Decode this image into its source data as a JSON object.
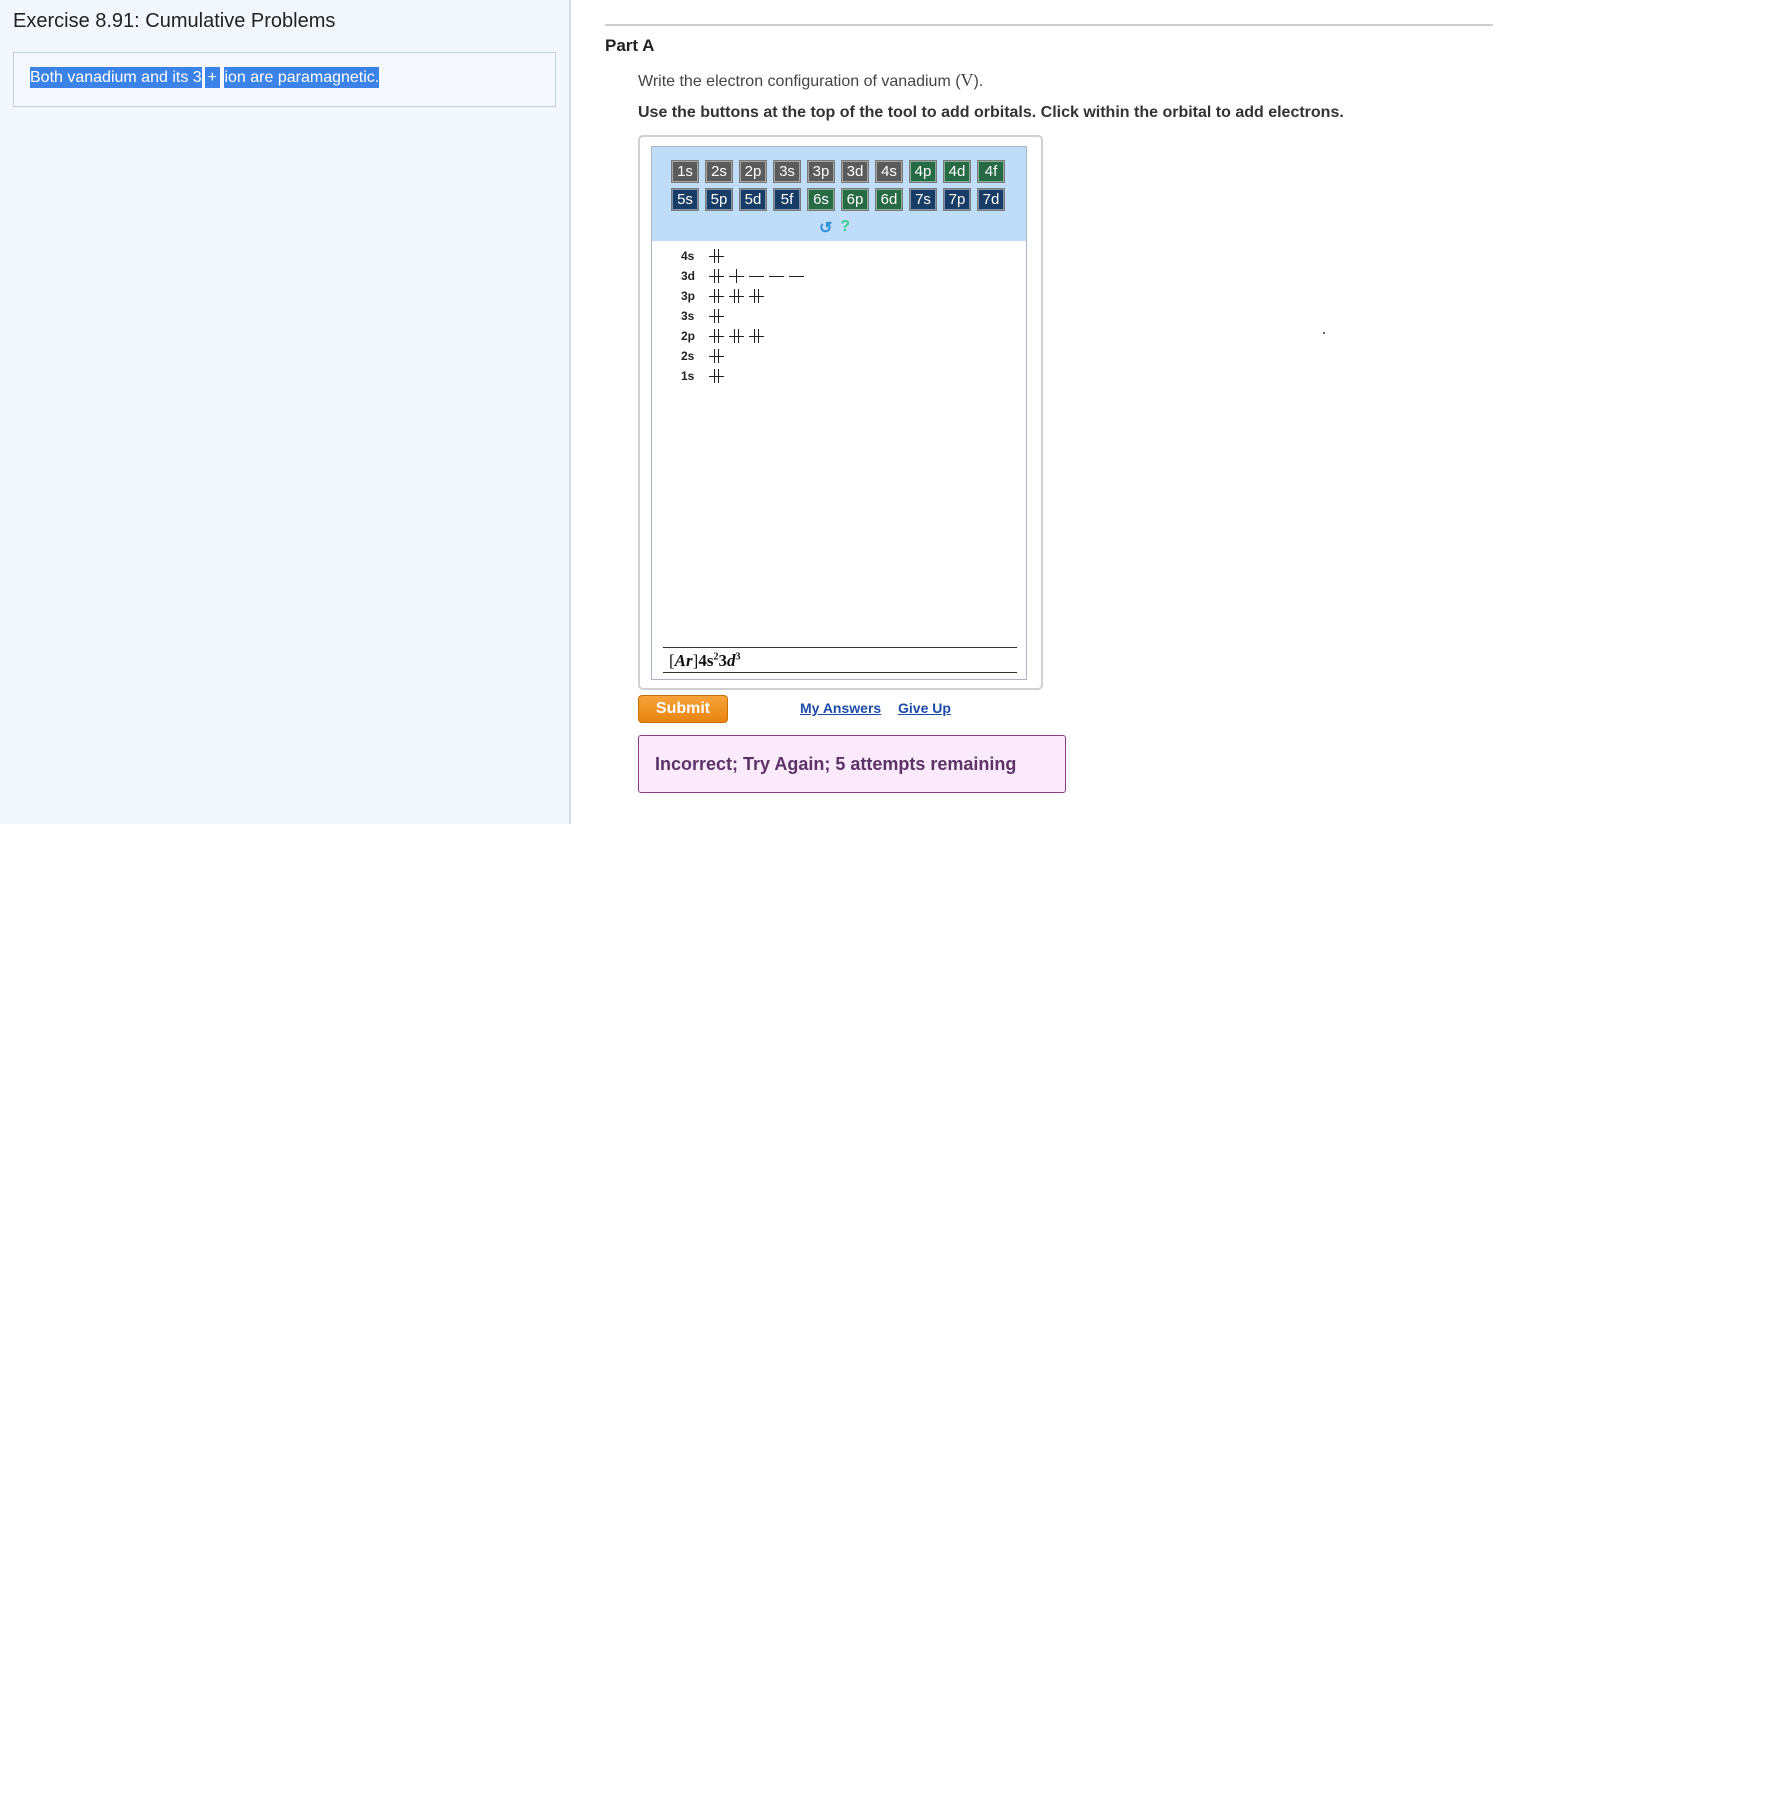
{
  "exercise": {
    "title": "Exercise 8.91: Cumulative Problems",
    "statement": {
      "part1": "Both vanadium and its 3",
      "part2": "+",
      "part3": "ion are paramagnetic."
    }
  },
  "part": {
    "label": "Part A",
    "prompt_prefix": "Write the electron configuration of vanadium (",
    "prompt_symbol": "V",
    "prompt_suffix": ").",
    "instruction": "Use the buttons at the top of the tool to add orbitals. Click within the orbital to add electrons."
  },
  "tool": {
    "buttons_row1": [
      {
        "label": "1s",
        "color": "#5b5b5b"
      },
      {
        "label": "2s",
        "color": "#5b5b5b"
      },
      {
        "label": "2p",
        "color": "#5b5b5b"
      },
      {
        "label": "3s",
        "color": "#5b5b5b"
      },
      {
        "label": "3p",
        "color": "#5b5b5b"
      },
      {
        "label": "3d",
        "color": "#5b5b5b"
      },
      {
        "label": "4s",
        "color": "#5b5b5b"
      },
      {
        "label": "4p",
        "color": "#276b45"
      },
      {
        "label": "4d",
        "color": "#276b45"
      },
      {
        "label": "4f",
        "color": "#276b45"
      }
    ],
    "buttons_row2": [
      {
        "label": "5s",
        "color": "#173d66"
      },
      {
        "label": "5p",
        "color": "#173d66"
      },
      {
        "label": "5d",
        "color": "#173d66"
      },
      {
        "label": "5f",
        "color": "#173d66"
      },
      {
        "label": "6s",
        "color": "#276b45"
      },
      {
        "label": "6p",
        "color": "#276b45"
      },
      {
        "label": "6d",
        "color": "#276b45"
      },
      {
        "label": "7s",
        "color": "#173d66"
      },
      {
        "label": "7p",
        "color": "#173d66"
      },
      {
        "label": "7d",
        "color": "#173d66"
      }
    ],
    "icons": [
      "undo-icon",
      "help-icon"
    ],
    "orbitals": [
      {
        "label": "4s",
        "slots": [
          2
        ]
      },
      {
        "label": "3d",
        "slots": [
          2,
          1,
          0,
          0,
          0
        ]
      },
      {
        "label": "3p",
        "slots": [
          2,
          2,
          2
        ]
      },
      {
        "label": "3s",
        "slots": [
          2
        ]
      },
      {
        "label": "2p",
        "slots": [
          2,
          2,
          2
        ]
      },
      {
        "label": "2s",
        "slots": [
          2
        ]
      },
      {
        "label": "1s",
        "slots": [
          2
        ]
      }
    ],
    "answer": {
      "core": "Ar",
      "t1": "4s",
      "e1": "2",
      "t2_num": "3",
      "t2_let": "d",
      "e2": "3"
    }
  },
  "actions": {
    "submit": "Submit",
    "my_answers": "My Answers",
    "give_up": "Give Up"
  },
  "feedback": {
    "text": "Incorrect; Try Again; 5 attempts remaining",
    "border_color": "#8a3a8d",
    "bg_color": "#fbe9fc"
  }
}
